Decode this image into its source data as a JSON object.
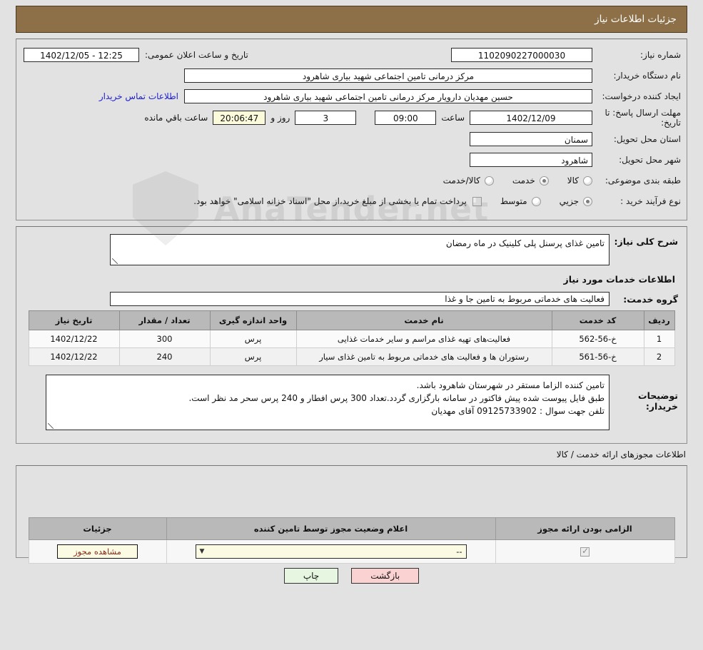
{
  "header": {
    "title": "جزئیات اطلاعات نیاز"
  },
  "info": {
    "need_number_label": "شماره نیاز:",
    "need_number_value": "1102090227000030",
    "announce_label": "تاریخ و ساعت اعلان عمومی:",
    "announce_value": "12:25 - 1402/12/05",
    "buyer_org_label": "نام دستگاه خریدار:",
    "buyer_org_value": "مرکز درمانی تامین اجتماعی شهید بیاری شاهرود",
    "creator_label": "ایجاد کننده درخواست:",
    "creator_value": "حسین مهدیان دارویار مرکز درمانی تامین اجتماعی شهید بیاری شاهرود",
    "contact_link": "اطلاعات تماس خریدار",
    "deadline_label": "مهلت ارسال پاسخ: تا تاریخ:",
    "deadline_date": "1402/12/09",
    "deadline_hour_label": "ساعت",
    "deadline_hour": "09:00",
    "days_left": "3",
    "days_label": "روز و",
    "time_left": "20:06:47",
    "time_left_label": "ساعت باقي مانده",
    "province_label": "استان محل تحویل:",
    "province_value": "سمنان",
    "city_label": "شهر محل تحویل:",
    "city_value": "شاهرود",
    "category_label": "طبقه بندی موضوعی:",
    "category_options": [
      {
        "label": "کالا",
        "selected": false
      },
      {
        "label": "خدمت",
        "selected": true
      },
      {
        "label": "کالا/خدمت",
        "selected": false
      }
    ],
    "process_label": "نوع فرآیند خرید :",
    "process_options": [
      {
        "label": "جزیي",
        "selected": true
      },
      {
        "label": "متوسط",
        "selected": false
      }
    ],
    "treasury_checkbox_checked": false,
    "treasury_text": "پرداخت تمام یا بخشی از مبلغ خرید،از محل \"اسناد خزانه اسلامی\" خواهد بود."
  },
  "description": {
    "general_label": "شرح کلی نیاز:",
    "general_value": "تامین غذای پرسنل پلی کلینیک در ماه رمضان",
    "services_heading": "اطلاعات خدمات مورد نیاز",
    "group_label": "گروه خدمت:",
    "group_value": "فعالیت های خدماتی مربوط به تامین جا و غذا"
  },
  "items_table": {
    "columns": [
      "ردیف",
      "کد خدمت",
      "نام خدمت",
      "واحد اندازه گیری",
      "تعداد / مقدار",
      "تاریخ نیاز"
    ],
    "rows": [
      {
        "row": "1",
        "code": "خ-56-562",
        "name": "فعالیت‌های تهیه غذای مراسم و سایر خدمات غذایی",
        "unit": "پرس",
        "quantity": "300",
        "date": "1402/12/22"
      },
      {
        "row": "2",
        "code": "خ-56-561",
        "name": "رستوران ها و فعالیت های خدماتی مربوط به تامین غذای سیار",
        "unit": "پرس",
        "quantity": "240",
        "date": "1402/12/22"
      }
    ]
  },
  "buyer_notes": {
    "label": "توضیحات خریدار:",
    "lines": [
      "تامین کننده الزاما مستقر در شهرستان شاهرود باشد.",
      "طبق فایل پیوست شده پیش فاکتور در سامانه بارگزاری گردد.تعداد 300 پرس افطار و 240 پرس سحر مد نظر است.",
      "تلفن جهت سوال : 09125733902 آقای مهدیان"
    ]
  },
  "permits": {
    "section_title": "اطلاعات مجوزهای ارائه خدمت / کالا",
    "columns": [
      "الزامی بودن ارائه مجوز",
      "اعلام وضعیت مجوز توسط تامین کننده",
      "جزئیات"
    ],
    "rows": [
      {
        "required_checked": true,
        "status_value": "--",
        "details_button": "مشاهده مجوز"
      }
    ]
  },
  "footer": {
    "print_label": "چاپ",
    "back_label": "بازگشت"
  },
  "watermark": {
    "text": "AnaTender.net",
    "sub": ""
  },
  "colors": {
    "header_brown": "#8d7048",
    "page_bg": "#e2e2e2",
    "link_blue": "#2020cf",
    "highlight_yellow": "#fbfbdc",
    "back_btn_pink": "#fbd2d2",
    "print_btn_green": "#e7f6e0",
    "table_header_gray": "#b9b9b9"
  }
}
